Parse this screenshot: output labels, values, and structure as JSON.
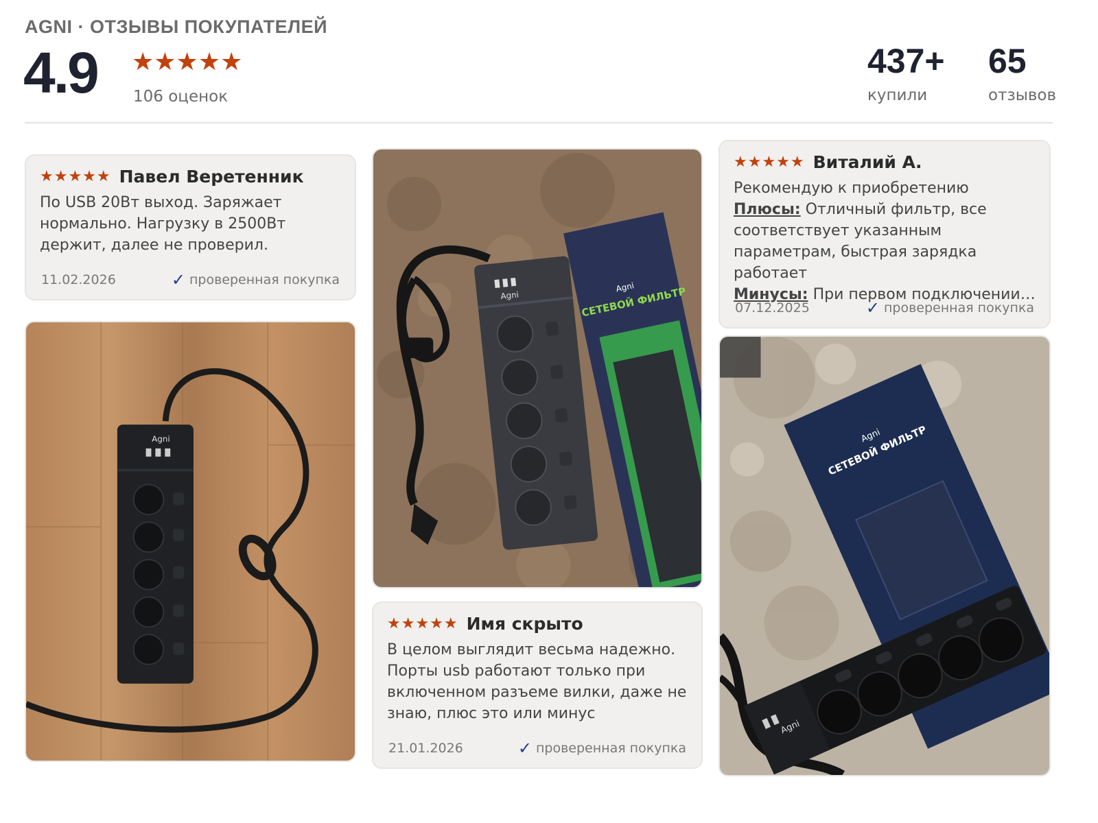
{
  "header": {
    "title": "AGNI · ОТЗЫВЫ ПОКУПАТЕЛЕЙ",
    "rating": "4.9",
    "stars": "★★★★★",
    "rating_count": "106 оценок",
    "bought_value": "437+",
    "bought_label": "купили",
    "reviews_value": "65",
    "reviews_label": "отзывов"
  },
  "colors": {
    "star": "#c2410c",
    "verified_check": "#1c3f8a",
    "card_bg": "#f1f0ee"
  },
  "reviews": [
    {
      "stars": "★★★★★",
      "author": "Павел Веретенник",
      "text": "По USB 20Вт выход. Заряжает нормально. Нагрузку в 2500Вт держит, далее не проверил.",
      "date": "11.02.2026",
      "verified": "проверенная покупка"
    },
    {
      "stars": "★★★★★",
      "author": "Имя скрыто",
      "text": "В целом выглядит весьма надежно. Порты usb работают только при включенном разъеме вилки, даже не знаю, плюс это или минус",
      "date": "21.01.2026",
      "verified": "проверенная покупка"
    },
    {
      "stars": "★★★★★",
      "author": "Виталий А.",
      "line1": "Рекомендую к приобретению",
      "plus_label": "Плюсы:",
      "plus_text": " Отличный фильтр, все соответствует указанным параметрам, быстрая зарядка работает",
      "minus_label": "Минусы:",
      "minus_text": " При первом подключении…",
      "date": "07.12.2025",
      "verified": "проверенная покупка"
    }
  ],
  "photos": [
    {
      "icon": "power-strip-photo",
      "brand_text": "Agni"
    },
    {
      "icon": "power-strip-photo",
      "brand_text": "Agni",
      "box_text": "СЕТЕВОЙ ФИЛЬТР"
    },
    {
      "icon": "power-strip-photo",
      "brand_text": "Agni",
      "box_text": "СЕТЕВОЙ ФИЛЬТР"
    }
  ]
}
